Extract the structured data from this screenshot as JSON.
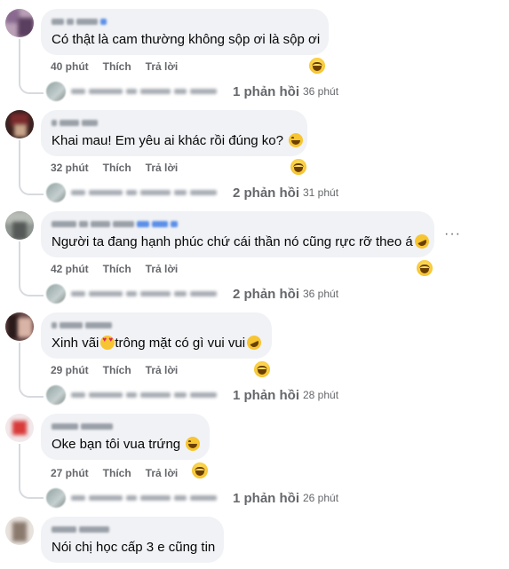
{
  "comments": [
    {
      "text": "Có thật là cam thường không sộp ơi là sộp ơi",
      "time": "40 phút",
      "like": "Thích",
      "reply": "Trả lời",
      "reply_count": "1 phản hồi",
      "reply_time": "36 phút"
    },
    {
      "text": "Khai mau! Em yêu ai khác rồi đúng ko?",
      "time": "32 phút",
      "like": "Thích",
      "reply": "Trả lời",
      "reply_count": "2 phản hồi",
      "reply_time": "31 phút"
    },
    {
      "text": "Người ta đang hạnh phúc chứ cái thần nó cũng rực rỡ theo á",
      "time": "42 phút",
      "like": "Thích",
      "reply": "Trả lời",
      "reply_count": "2 phản hồi",
      "reply_time": "36 phút"
    },
    {
      "text_before": "Xinh vãi",
      "text_after": "trông mặt có gì vui vui",
      "time": "29 phút",
      "like": "Thích",
      "reply": "Trả lời",
      "reply_count": "1 phản hồi",
      "reply_time": "28 phút"
    },
    {
      "text": "Oke bạn tôi vua trứng",
      "time": "27 phút",
      "like": "Thích",
      "reply": "Trả lời",
      "reply_count": "1 phản hồi",
      "reply_time": "26 phút"
    },
    {
      "text": "Nói chị học cấp 3 e cũng tin"
    }
  ],
  "more_menu": "···",
  "colors": {
    "bubble": "#f0f2f5",
    "meta": "#65676b",
    "thread": "#d7dadf",
    "emoji": "#f7c531"
  },
  "icons": [
    "laughing-reaction-icon",
    "grinning-squinting-emoji",
    "rofl-emoji",
    "heart-eyes-emoji",
    "more-options-icon"
  ]
}
